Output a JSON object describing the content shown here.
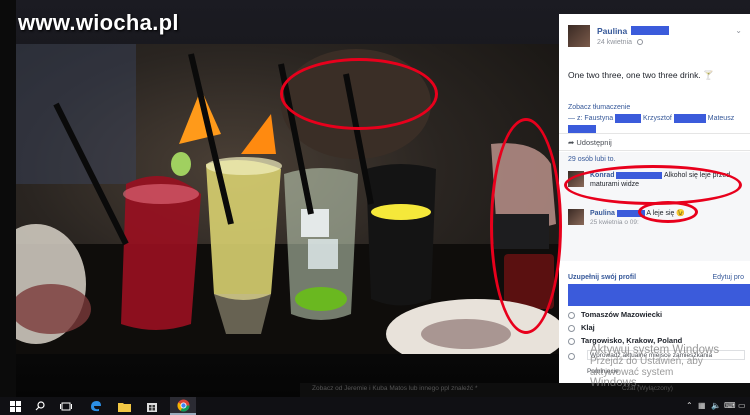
{
  "watermark": "www.wiocha.pl",
  "post": {
    "author": "Paulina",
    "date": "24 kwietnia",
    "text": "One two three, one two three drink. 🍸",
    "see_translation": "Zobacz tłumaczenie",
    "tagged_prefix": "— z:",
    "tagged_names": [
      "Faustyna",
      "Krzysztof",
      "Mateusz"
    ],
    "share_label": "Udostępnij",
    "likes": "29 osób lubi to."
  },
  "comments": [
    {
      "name": "Konrad",
      "text": "Alkohol się leje przed maturami widze"
    },
    {
      "name": "Paulina",
      "text": "A leje się 😉",
      "meta": "25 kwietnia o 09:"
    }
  ],
  "profile": {
    "title": "Uzupełnij swój profil",
    "edit": "Edytuj pro",
    "options": [
      "Tomaszów Mazowiecki",
      "Klaj",
      "Targowisko, Krakow, Poland"
    ],
    "input_placeholder": "Wprowadź aktualne miejsce zamieszkania",
    "footer": "Pominięcie"
  },
  "activate_windows": {
    "line1": "Aktywuj system Windows",
    "line2": "Przejdź do Ustawień, aby aktywować system",
    "line3": "Windows."
  },
  "chat": {
    "left": "Zobacz od Jeremie i Kuba Matos lub innego ppl znaleźć *",
    "right": "Czat (Wyłączony)"
  },
  "colors": {
    "highlight": "#e8001c",
    "facebook_link": "#365899",
    "redaction": "#3b5bdb",
    "taskbar": "#101014"
  },
  "taskbar_icons": [
    "windows-start-icon",
    "search-icon",
    "task-view-icon",
    "edge-icon",
    "file-explorer-icon",
    "store-icon",
    "chrome-icon"
  ],
  "tray_icons": [
    "chevron-up-icon",
    "network-icon",
    "volume-icon",
    "keyboard-icon",
    "notification-icon"
  ]
}
